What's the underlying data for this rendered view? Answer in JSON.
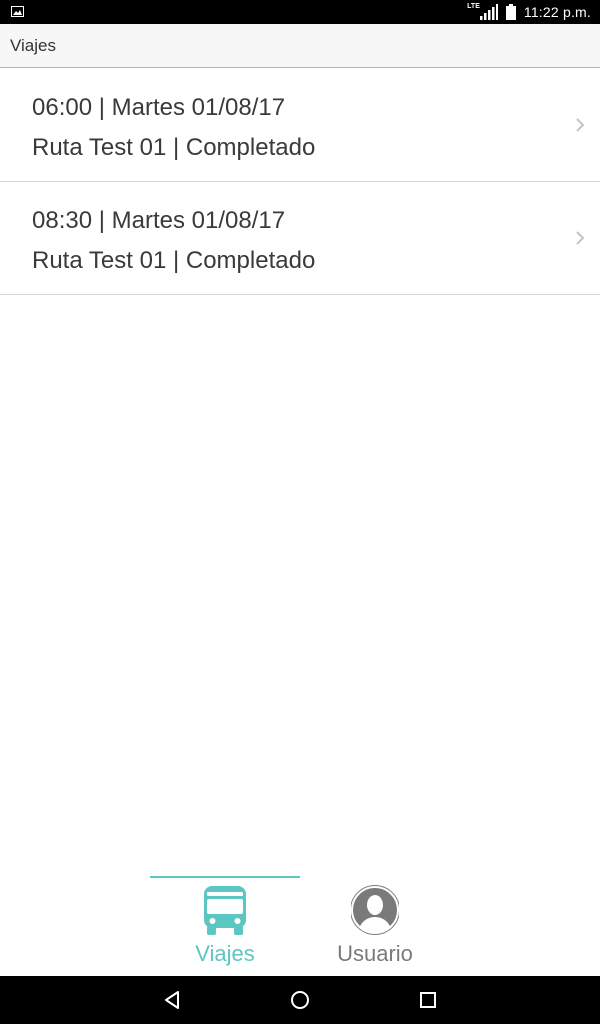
{
  "status_bar": {
    "network_label": "LTE",
    "time": "11:22 p.m."
  },
  "app_bar": {
    "title": "Viajes"
  },
  "trips": [
    {
      "line1": "06:00 | Martes 01/08/17",
      "line2": "Ruta Test 01 | Completado"
    },
    {
      "line1": "08:30 | Martes 01/08/17",
      "line2": "Ruta Test 01 | Completado"
    }
  ],
  "tabs": [
    {
      "label": "Viajes",
      "icon": "bus-icon",
      "active": true
    },
    {
      "label": "Usuario",
      "icon": "user-avatar-icon",
      "active": false
    }
  ],
  "colors": {
    "accent": "#5cc6c3",
    "inactive": "#7a7a7a",
    "text": "#3a3a3a"
  }
}
